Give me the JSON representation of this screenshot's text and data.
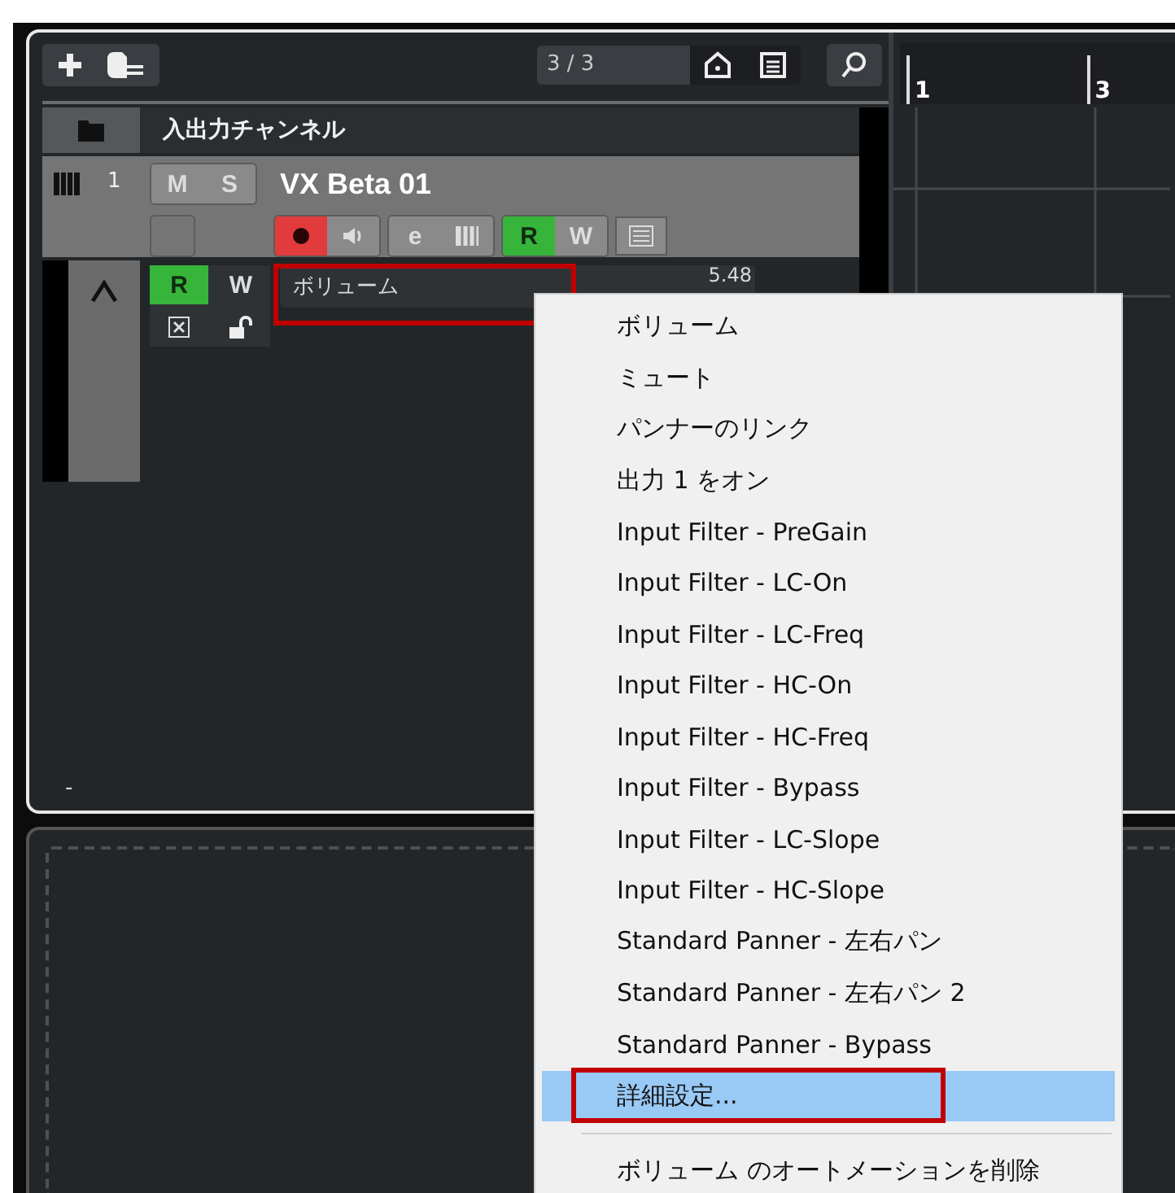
{
  "toolbar": {
    "counter": "3 / 3"
  },
  "tracks": {
    "folder": {
      "name": "入出力チャンネル"
    },
    "instrument": {
      "number": "1",
      "name": "VX Beta 01",
      "mute": {
        "label": "M",
        "on": false
      },
      "solo": {
        "label": "S",
        "on": false
      },
      "record": {
        "on": true
      },
      "monitor": {
        "on": false
      },
      "edit": {
        "label": "e"
      },
      "read": {
        "label": "R",
        "on": true
      },
      "write": {
        "label": "W",
        "on": false
      }
    },
    "automation": {
      "read": {
        "label": "R",
        "on": true
      },
      "write": {
        "label": "W",
        "on": false
      },
      "parameter": "ボリューム",
      "value": "5.48",
      "annotated": true
    }
  },
  "ruler": {
    "bars": [
      "1",
      "3"
    ]
  },
  "status": {
    "text": "-"
  },
  "context_menu": {
    "items": [
      {
        "label": "ボリューム",
        "selected": false,
        "annotated": false
      },
      {
        "label": "ミュート",
        "selected": false,
        "annotated": false
      },
      {
        "label": "パンナーのリンク",
        "selected": false,
        "annotated": false
      },
      {
        "label": "出力 1 をオン",
        "selected": false,
        "annotated": false
      },
      {
        "label": "Input Filter - PreGain",
        "selected": false,
        "annotated": false
      },
      {
        "label": "Input Filter - LC-On",
        "selected": false,
        "annotated": false
      },
      {
        "label": "Input Filter - LC-Freq",
        "selected": false,
        "annotated": false
      },
      {
        "label": "Input Filter - HC-On",
        "selected": false,
        "annotated": false
      },
      {
        "label": "Input Filter - HC-Freq",
        "selected": false,
        "annotated": false
      },
      {
        "label": "Input Filter - Bypass",
        "selected": false,
        "annotated": false
      },
      {
        "label": "Input Filter - LC-Slope",
        "selected": false,
        "annotated": false
      },
      {
        "label": "Input Filter - HC-Slope",
        "selected": false,
        "annotated": false
      },
      {
        "label": "Standard Panner - 左右パン",
        "selected": false,
        "annotated": false
      },
      {
        "label": "Standard Panner - 左右パン 2",
        "selected": false,
        "annotated": false
      },
      {
        "label": "Standard Panner - Bypass",
        "selected": false,
        "annotated": false
      },
      {
        "label": "詳細設定...",
        "selected": true,
        "annotated": true
      },
      {
        "kind": "separator"
      },
      {
        "label": "ボリューム のオートメーションを削除",
        "selected": false,
        "annotated": false
      }
    ]
  }
}
